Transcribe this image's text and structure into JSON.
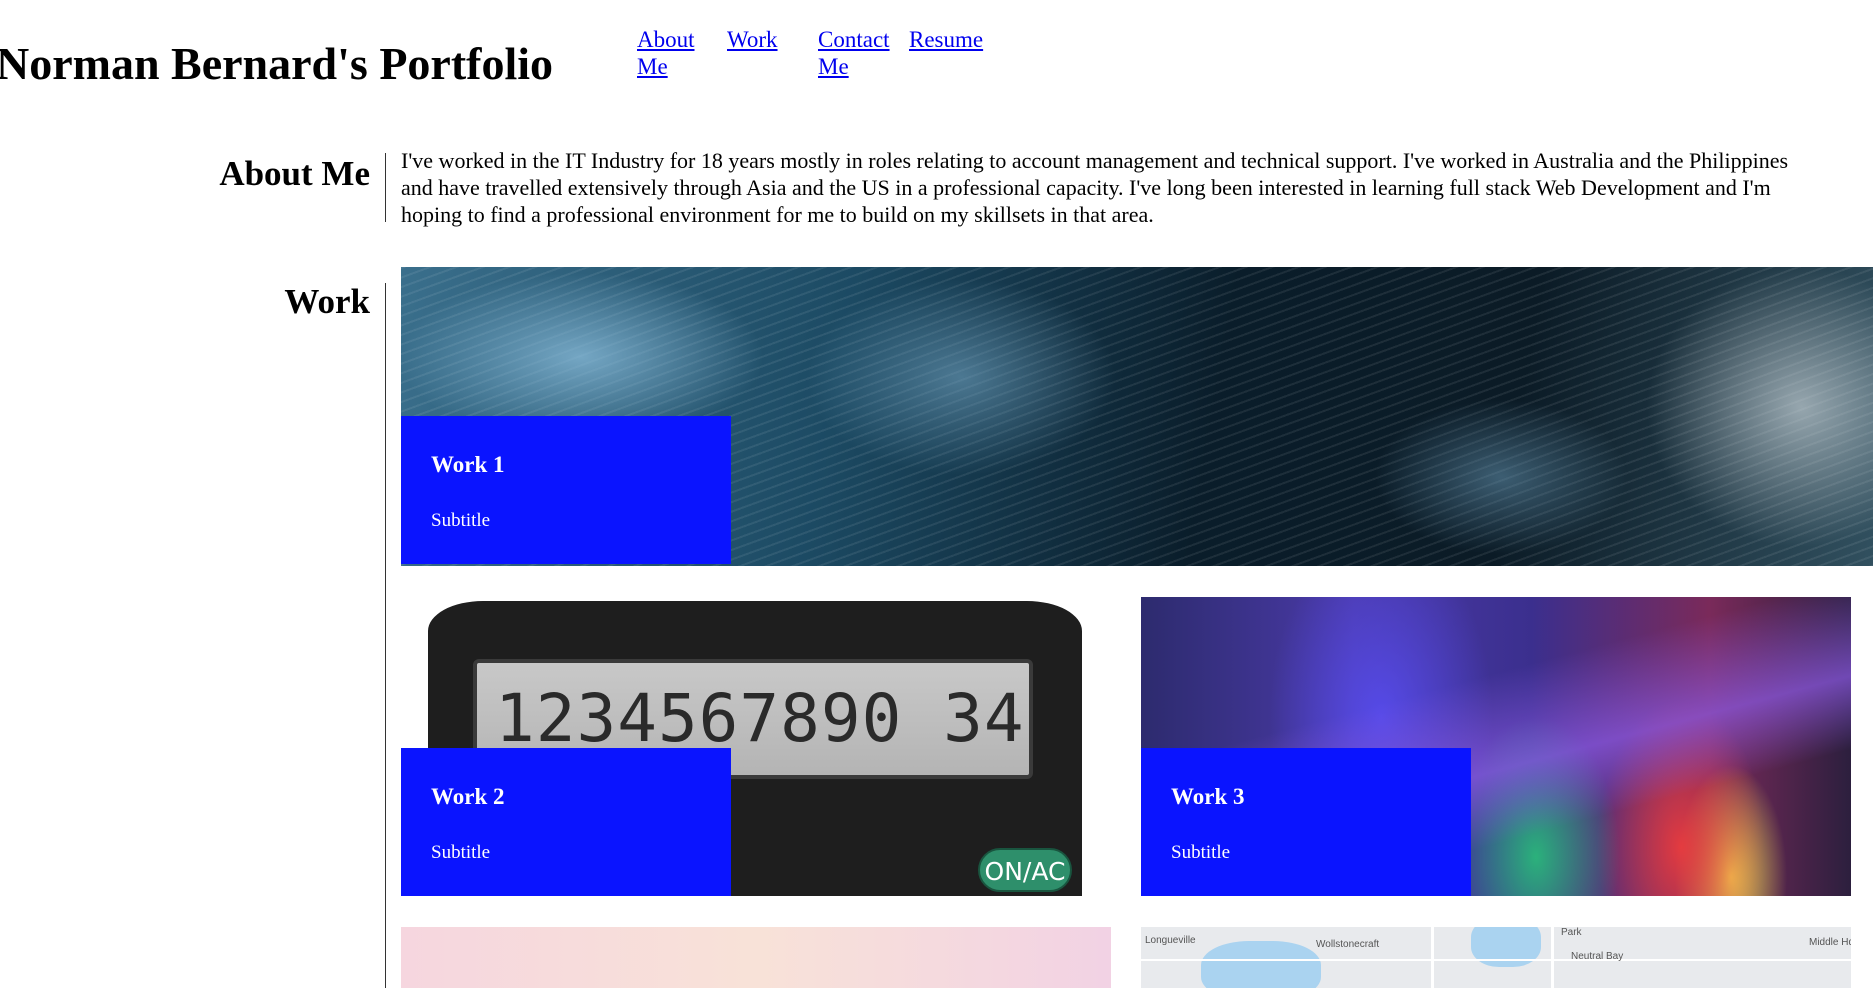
{
  "header": {
    "title": "Norman Bernard's Portfolio",
    "nav": [
      {
        "label": "About Me"
      },
      {
        "label": "Work"
      },
      {
        "label": "Contact Me"
      },
      {
        "label": "Resume"
      }
    ]
  },
  "about": {
    "heading": "About Me",
    "text": "I've worked in the IT Industry for 18 years mostly in roles relating to account management and technical support. I've worked in Australia and the Philippines and have travelled extensively through Asia and the US in a professional capacity. I've long been interested in learning full stack Web Development and I'm hoping to find a professional environment for me to build on my skillsets in that area."
  },
  "work": {
    "heading": "Work",
    "cards": [
      {
        "title": "Work 1",
        "subtitle": "Subtitle",
        "image": "ocean-waves"
      },
      {
        "title": "Work 2",
        "subtitle": "Subtitle",
        "image": "calculator"
      },
      {
        "title": "Work 3",
        "subtitle": "Subtitle",
        "image": "colored-lights"
      },
      {
        "image": "pink-sky"
      },
      {
        "image": "street-map"
      }
    ],
    "calculator": {
      "display": "1234567890 34",
      "key_label": "ON/AC"
    },
    "map": {
      "labels": [
        "Longueville",
        "Wollstonecraft",
        "Neutral Bay",
        "Park",
        "Middle Hd"
      ]
    }
  },
  "colors": {
    "caption_bg": "#0a14ff",
    "link": "#0000ee"
  }
}
